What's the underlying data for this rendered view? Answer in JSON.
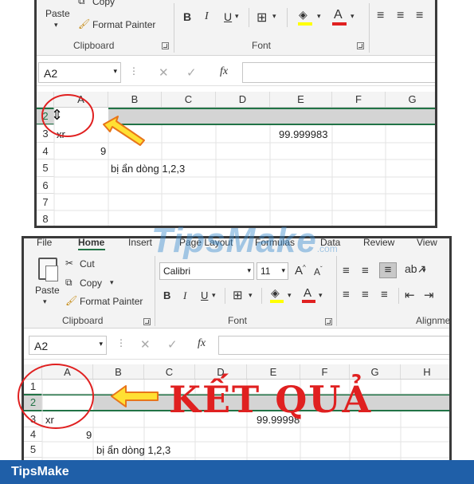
{
  "top": {
    "ribbon": {
      "paste_label": "Paste",
      "copy_label": "Copy",
      "format_painter_label": "Format Painter",
      "clipboard_group": "Clipboard",
      "font_group": "Font",
      "bold": "B",
      "italic": "I",
      "underline": "U"
    },
    "namebox_value": "A2",
    "fx_label": "fx",
    "columns": [
      "A",
      "B",
      "C",
      "D",
      "E",
      "F",
      "G"
    ],
    "rows": [
      "2",
      "3",
      "4",
      "5",
      "6",
      "7",
      "8"
    ],
    "cells": {
      "a3": "xr",
      "e3": "99.999983",
      "a4": "9",
      "b5": "bị ẩn dòng 1,2,3"
    }
  },
  "bottom": {
    "tabs": [
      "File",
      "Home",
      "Insert",
      "Page Layout",
      "Formulas",
      "Data",
      "Review",
      "View"
    ],
    "ribbon": {
      "paste_label": "Paste",
      "cut_label": "Cut",
      "copy_label": "Copy",
      "format_painter_label": "Format Painter",
      "clipboard_group": "Clipboard",
      "font_group": "Font",
      "alignment_group": "Alignmen",
      "font_name": "Calibri",
      "font_size": "11",
      "bold": "B",
      "italic": "I",
      "underline": "U"
    },
    "namebox_value": "A2",
    "fx_label": "fx",
    "columns": [
      "A",
      "B",
      "C",
      "D",
      "E",
      "F",
      "G",
      "H"
    ],
    "rows": [
      "1",
      "2",
      "3",
      "4",
      "5"
    ],
    "cells": {
      "a3": "xr",
      "e3": "99.99998",
      "a4": "9",
      "b5": "bị ẩn dòng 1,2,3"
    },
    "result_text": "KẾT QUẢ"
  },
  "watermark": "TipsMake",
  "watermark_suffix": ".com",
  "footer_brand": "TipsMake",
  "colors": {
    "accent_red": "#e02020",
    "arrow_yellow": "#ffe033",
    "arrow_orange": "#e8751a",
    "selection_green": "#217346",
    "footer_blue": "#1f5fa8"
  }
}
